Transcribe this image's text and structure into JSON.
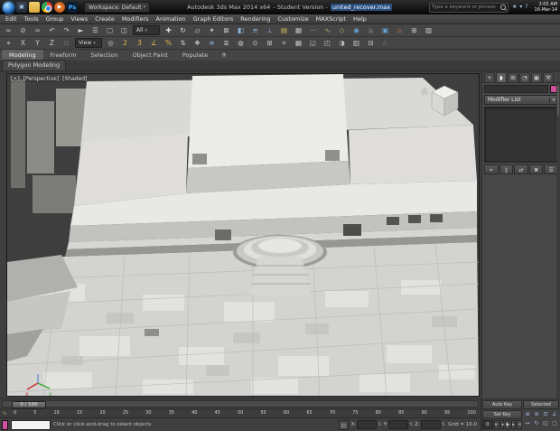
{
  "colors": {
    "object_color": "#d24f9e",
    "macro_recorder": "#d24f9e",
    "selection_accent": "#2a4f7e"
  },
  "taskbar": {
    "ps_label": "Ps",
    "clock_time": "2:05 AM",
    "clock_date": "16-Mar-14"
  },
  "titlebar": {
    "workspace": "Workspace: Default",
    "title_app": "Autodesk 3ds Max 2014 x64",
    "title_edition": "- Student Version -",
    "title_file": "united_recover.max",
    "search_placeholder": "Type a keyword or phrase",
    "infocenter": [
      {
        "name": "sign-in-icon",
        "glyph": "★"
      },
      {
        "name": "communication-center-icon",
        "glyph": "▾"
      },
      {
        "name": "help-icon",
        "glyph": "?"
      }
    ]
  },
  "menubar": {
    "items": [
      "Edit",
      "Tools",
      "Group",
      "Views",
      "Create",
      "Modifiers",
      "Animation",
      "Graph Editors",
      "Rendering",
      "Customize",
      "MAXScript",
      "Help"
    ]
  },
  "toolbar": {
    "selection_filter_value": "All",
    "ref_coord_value": "View",
    "row1_left": [
      {
        "name": "select-and-link-icon",
        "glyph": "∞",
        "color": "#c9c9c9"
      },
      {
        "name": "unlink-selection-icon",
        "glyph": "⊘",
        "color": "#c9c9c9"
      },
      {
        "name": "bind-to-spacewarp-icon",
        "glyph": "≈",
        "color": "#c9c9c9"
      },
      {
        "name": "undo-icon",
        "glyph": "↶",
        "color": "#c9c9c9"
      },
      {
        "name": "redo-icon",
        "glyph": "↷",
        "color": "#c9c9c9"
      },
      {
        "name": "select-object-icon",
        "glyph": "►",
        "color": "#dcdcdc"
      },
      {
        "name": "select-by-name-icon",
        "glyph": "☰",
        "color": "#c9c9c9"
      },
      {
        "name": "rectangular-selection-icon",
        "glyph": "▢",
        "color": "#c9c9c9"
      },
      {
        "name": "window-crossing-icon",
        "glyph": "◫",
        "color": "#c9c9c9"
      }
    ],
    "row1_right": [
      {
        "name": "select-and-move-icon",
        "glyph": "✚",
        "color": "#dcdcdc"
      },
      {
        "name": "select-and-rotate-icon",
        "glyph": "↻",
        "color": "#dcdcdc"
      },
      {
        "name": "select-and-scale-icon",
        "glyph": "▱",
        "color": "#dcdcdc"
      },
      {
        "name": "select-and-manipulate-icon",
        "glyph": "✦",
        "color": "#c9c9c9"
      },
      {
        "name": "keyboard-override-icon",
        "glyph": "⊠",
        "color": "#c9c9c9"
      },
      {
        "name": "mirror-icon",
        "glyph": "◧",
        "color": "#8fb7e0"
      },
      {
        "name": "align-icon",
        "glyph": "≡",
        "color": "#8fb7e0"
      },
      {
        "name": "normal-align-icon",
        "glyph": "⊥",
        "color": "#8fb7e0"
      },
      {
        "name": "layer-manager-icon",
        "glyph": "▤",
        "color": "#d8c35b"
      },
      {
        "name": "graphite-ribbon-icon",
        "glyph": "▦",
        "color": "#c9c9c9"
      },
      {
        "name": "spacing-tool-icon",
        "glyph": "⋯",
        "color": "#c9c9c9"
      },
      {
        "name": "curve-editor-icon",
        "glyph": "∿",
        "color": "#97c76a"
      },
      {
        "name": "schematic-view-icon",
        "glyph": "◇",
        "color": "#97c76a"
      },
      {
        "name": "material-editor-icon",
        "glyph": "◉",
        "color": "#66a3d8"
      },
      {
        "name": "render-setup-icon",
        "glyph": "♨",
        "color": "#c9c9c9"
      },
      {
        "name": "rendered-frame-icon",
        "glyph": "▣",
        "color": "#66a3d8"
      },
      {
        "name": "render-production-icon",
        "glyph": "♨",
        "color": "#e0854e"
      },
      {
        "name": "array-tool-icon",
        "glyph": "⊞",
        "color": "#c9c9c9"
      },
      {
        "name": "color-clipboard-icon",
        "glyph": "▧",
        "color": "#c9c9c9"
      }
    ],
    "row2_left": [
      {
        "name": "select-and-place-icon",
        "glyph": "⌖",
        "color": "#c9c9c9"
      },
      {
        "name": "axis-x-constraint-icon",
        "glyph": "X",
        "color": "#c9c9c9"
      },
      {
        "name": "axis-y-constraint-icon",
        "glyph": "Y",
        "color": "#c9c9c9"
      },
      {
        "name": "axis-z-constraint-icon",
        "glyph": "Z",
        "color": "#c9c9c9"
      },
      {
        "name": "axis-plane-constraint-icon",
        "glyph": "∷",
        "color": "#c9c9c9"
      }
    ],
    "row2_right": [
      {
        "name": "use-center-icon",
        "glyph": "◎",
        "color": "#c9c9c9"
      },
      {
        "name": "snap-2d-icon",
        "glyph": "2",
        "color": "#e3b64f"
      },
      {
        "name": "snap-3d-icon",
        "glyph": "3",
        "color": "#e3b64f"
      },
      {
        "name": "angle-snap-icon",
        "glyph": "∠",
        "color": "#e3b64f"
      },
      {
        "name": "percent-snap-icon",
        "glyph": "%",
        "color": "#e3b64f"
      },
      {
        "name": "spinner-snap-icon",
        "glyph": "⇅",
        "color": "#c9c9c9"
      },
      {
        "name": "named-selection-sets-icon",
        "glyph": "❖",
        "color": "#c9c9c9"
      },
      {
        "name": "quick-align-icon",
        "glyph": "≋",
        "color": "#8fb7e0"
      },
      {
        "name": "scene-explorer-icon",
        "glyph": "≣",
        "color": "#c9c9c9"
      },
      {
        "name": "display-filter-icon",
        "glyph": "◍",
        "color": "#c9c9c9"
      },
      {
        "name": "isolate-selection-icon",
        "glyph": "⊙",
        "color": "#c9c9c9"
      },
      {
        "name": "grids-icon",
        "glyph": "⊞",
        "color": "#c9c9c9"
      },
      {
        "name": "measure-icon",
        "glyph": "⌗",
        "color": "#c9c9c9"
      },
      {
        "name": "array-icon",
        "glyph": "▦",
        "color": "#c9c9c9"
      },
      {
        "name": "viewport-layout-icon",
        "glyph": "◱",
        "color": "#c9c9c9"
      },
      {
        "name": "render-region-icon",
        "glyph": "◰",
        "color": "#c9c9c9"
      },
      {
        "name": "exposure-control-icon",
        "glyph": "◑",
        "color": "#c9c9c9"
      },
      {
        "name": "batch-render-icon",
        "glyph": "▥",
        "color": "#c9c9c9"
      },
      {
        "name": "state-sets-icon",
        "glyph": "⊟",
        "color": "#c9c9c9"
      },
      {
        "name": "more-tools-icon",
        "glyph": "∴",
        "color": "#c9c9c9"
      }
    ]
  },
  "ribbon": {
    "tabs": [
      {
        "label": "Modeling",
        "active": true
      },
      {
        "label": "Freeform",
        "active": false
      },
      {
        "label": "Selection",
        "active": false
      },
      {
        "label": "Object Paint",
        "active": false
      },
      {
        "label": "Populate",
        "active": false
      }
    ],
    "panel_tab": "Polygon Modeling"
  },
  "viewport": {
    "menu_plus": "[+]",
    "menu_pov": "[Perspective]",
    "menu_shading": "[Shaded]"
  },
  "command_panel": {
    "tabs": [
      {
        "name": "tab-create-icon",
        "glyph": "+",
        "active": false
      },
      {
        "name": "tab-modify-icon",
        "glyph": "◗",
        "active": true
      },
      {
        "name": "tab-hierarchy-icon",
        "glyph": "⊞",
        "active": false
      },
      {
        "name": "tab-motion-icon",
        "glyph": "◔",
        "active": false
      },
      {
        "name": "tab-display-icon",
        "glyph": "▣",
        "active": false
      },
      {
        "name": "tab-utilities-icon",
        "glyph": "⚒",
        "active": false
      }
    ],
    "modifier_list_label": "Modifier List",
    "stack_buttons": [
      {
        "name": "pin-stack-button",
        "glyph": "⌖"
      },
      {
        "name": "show-end-result-button",
        "glyph": "∥"
      },
      {
        "name": "make-unique-button",
        "glyph": "⇄"
      },
      {
        "name": "remove-modifier-button",
        "glyph": "✖"
      },
      {
        "name": "configure-modifier-sets-button",
        "glyph": "☰"
      }
    ]
  },
  "timeline": {
    "slider_label": "0 / 100",
    "ticks": [
      "0",
      "5",
      "10",
      "15",
      "20",
      "25",
      "30",
      "35",
      "40",
      "45",
      "50",
      "55",
      "60",
      "65",
      "70",
      "75",
      "80",
      "85",
      "90",
      "95",
      "100"
    ]
  },
  "status_bar": {
    "prompt": "Click or click-and-drag to select objects",
    "coord_labels": [
      "X:",
      "Y:",
      "Z:"
    ],
    "grid_label": "Grid = 10.0"
  },
  "animation": {
    "auto_key_label": "Auto Key",
    "set_key_label": "Set Key",
    "selected_label": "Selected",
    "frame_value": "0",
    "transport": [
      {
        "name": "go-to-start-icon",
        "glyph": "⇤"
      },
      {
        "name": "previous-frame-icon",
        "glyph": "◂"
      },
      {
        "name": "play-animation-icon",
        "glyph": "▶"
      },
      {
        "name": "next-frame-icon",
        "glyph": "▸"
      },
      {
        "name": "go-to-end-icon",
        "glyph": "⇥"
      }
    ]
  },
  "nav_controls": [
    {
      "name": "zoom-icon",
      "glyph": "⊕"
    },
    {
      "name": "zoom-all-icon",
      "glyph": "⊛"
    },
    {
      "name": "zoom-extents-icon",
      "glyph": "⊡"
    },
    {
      "name": "fov-icon",
      "glyph": "∠"
    },
    {
      "name": "pan-icon",
      "glyph": "↔"
    },
    {
      "name": "orbit-icon",
      "glyph": "↻"
    },
    {
      "name": "maximize-viewport-icon",
      "glyph": "◱"
    },
    {
      "name": "zoom-region-icon",
      "glyph": "▢"
    }
  ]
}
